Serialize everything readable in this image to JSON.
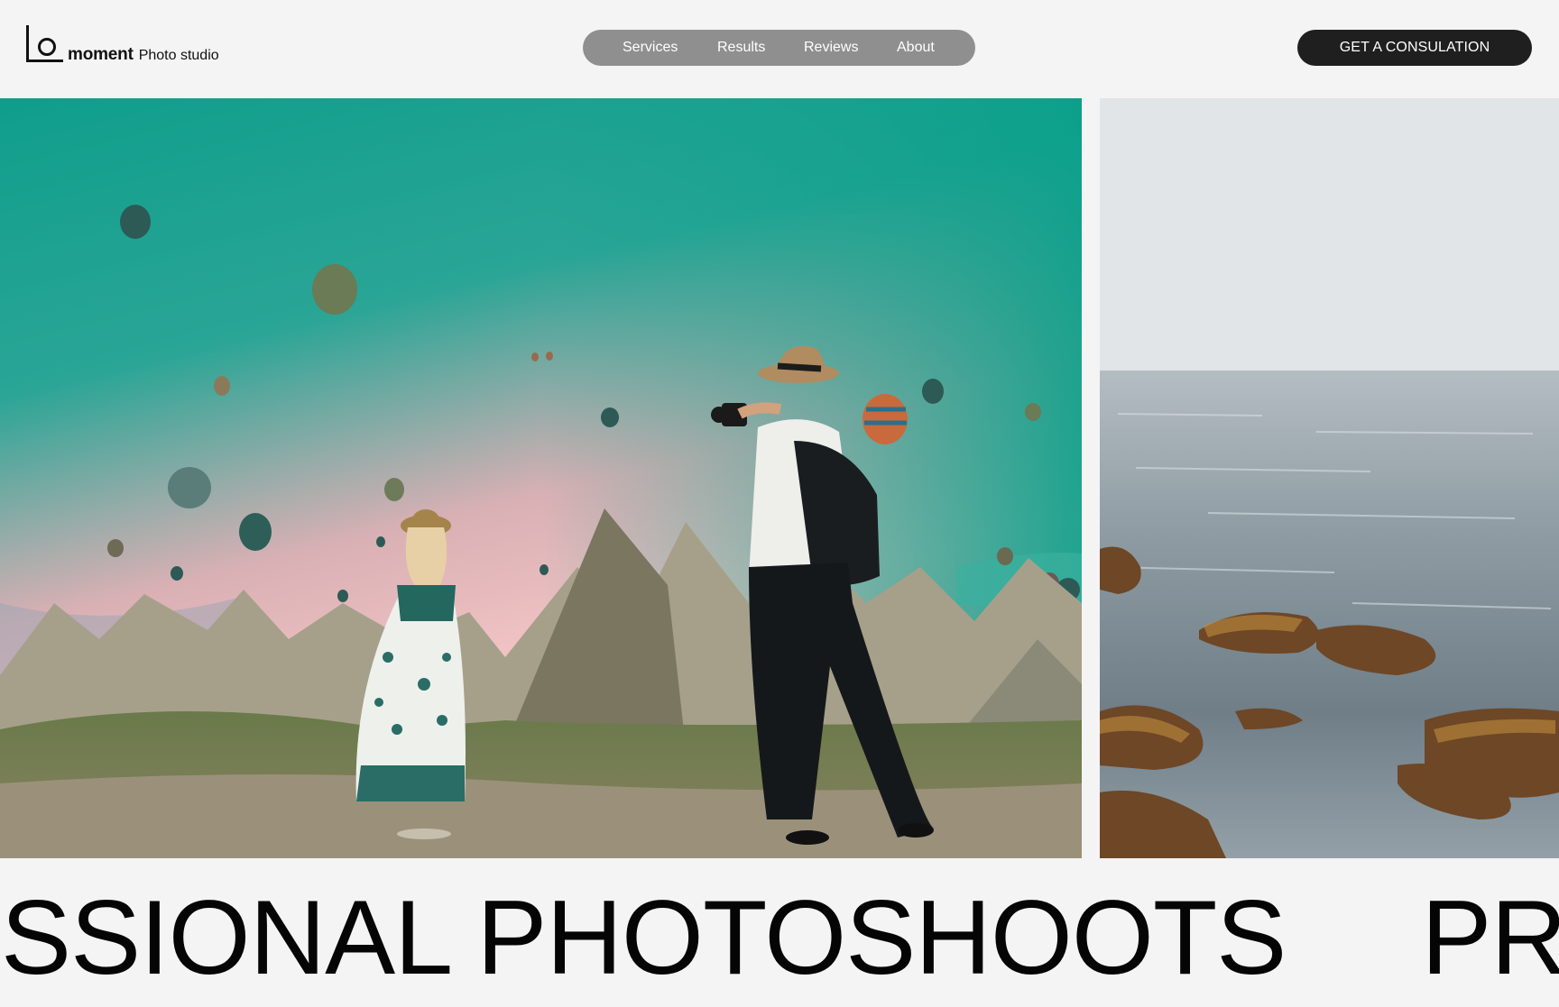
{
  "brand": {
    "name": "moment",
    "tagline": "Photo studio"
  },
  "nav": {
    "items": [
      "Services",
      "Results",
      "Reviews",
      "About"
    ]
  },
  "cta": {
    "label": "GET A CONSULATION"
  },
  "gallery": {
    "images": [
      {
        "subject": "couple-balloons-cappadocia"
      },
      {
        "subject": "sea-rocks-shore"
      }
    ]
  },
  "marquee": {
    "text": "PROFESSIONAL PHOTOSHOOTS"
  },
  "colors": {
    "background": "#f4f4f4",
    "nav_pill": "#8f8f8f",
    "cta_bg": "#1f1f1f",
    "text": "#111111"
  }
}
